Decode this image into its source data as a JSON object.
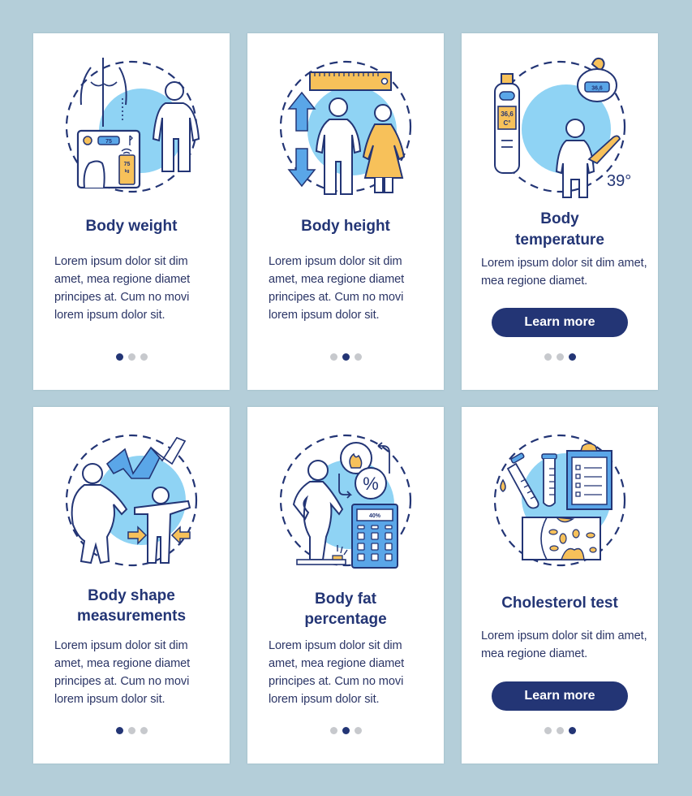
{
  "colors": {
    "background": "#b4ced9",
    "card": "#ffffff",
    "primary": "#233575",
    "accent_blue": "#8fd3f4",
    "accent_mid_blue": "#5aa6e8",
    "accent_yellow": "#f7c15a",
    "dot_inactive": "#c7c9cd"
  },
  "cards": [
    {
      "id": "body-weight",
      "icon": "body-weight-scale-icon",
      "title": "Body weight",
      "body": "Lorem ipsum dolor sit dim amet, mea regione diamet principes at. Cum no movi lorem ipsum dolor sit.",
      "illustration_labels": {
        "scale_display": "75",
        "phone_value": "75",
        "phone_unit": "kg"
      },
      "pagination": {
        "total": 3,
        "active": 1
      }
    },
    {
      "id": "body-height",
      "icon": "body-height-ruler-icon",
      "title": "Body height",
      "body": "Lorem ipsum dolor sit dim amet, mea regione diamet principes at. Cum no movi lorem ipsum dolor sit.",
      "pagination": {
        "total": 3,
        "active": 2
      }
    },
    {
      "id": "body-temperature",
      "icon": "thermometer-icon",
      "title": "Body temperature",
      "body": "Lorem ipsum dolor sit dim amet, mea regione diamet.",
      "button": "Learn more",
      "illustration_labels": {
        "device_value": "36,6",
        "device_unit": "C°",
        "pacifier_value": "36,6",
        "fever_value": "39°"
      },
      "pagination": {
        "total": 3,
        "active": 3
      }
    },
    {
      "id": "body-shape",
      "icon": "measuring-tape-icon",
      "title": "Body shape measurements",
      "body": "Lorem ipsum dolor sit dim amet, mea regione diamet principes at. Cum no movi lorem ipsum dolor sit.",
      "pagination": {
        "total": 3,
        "active": 1
      }
    },
    {
      "id": "body-fat",
      "icon": "calculator-percent-icon",
      "title": "Body fat percentage",
      "body": "Lorem ipsum dolor sit dim amet, mea regione diamet principes at. Cum no movi lorem ipsum dolor sit.",
      "illustration_labels": {
        "calculator_display": "40%",
        "badge": "%"
      },
      "pagination": {
        "total": 3,
        "active": 2
      }
    },
    {
      "id": "cholesterol-test",
      "icon": "test-tube-clipboard-icon",
      "title": "Cholesterol test",
      "body": "Lorem ipsum dolor sit dim amet, mea regione diamet.",
      "button": "Learn more",
      "pagination": {
        "total": 3,
        "active": 3
      }
    }
  ]
}
